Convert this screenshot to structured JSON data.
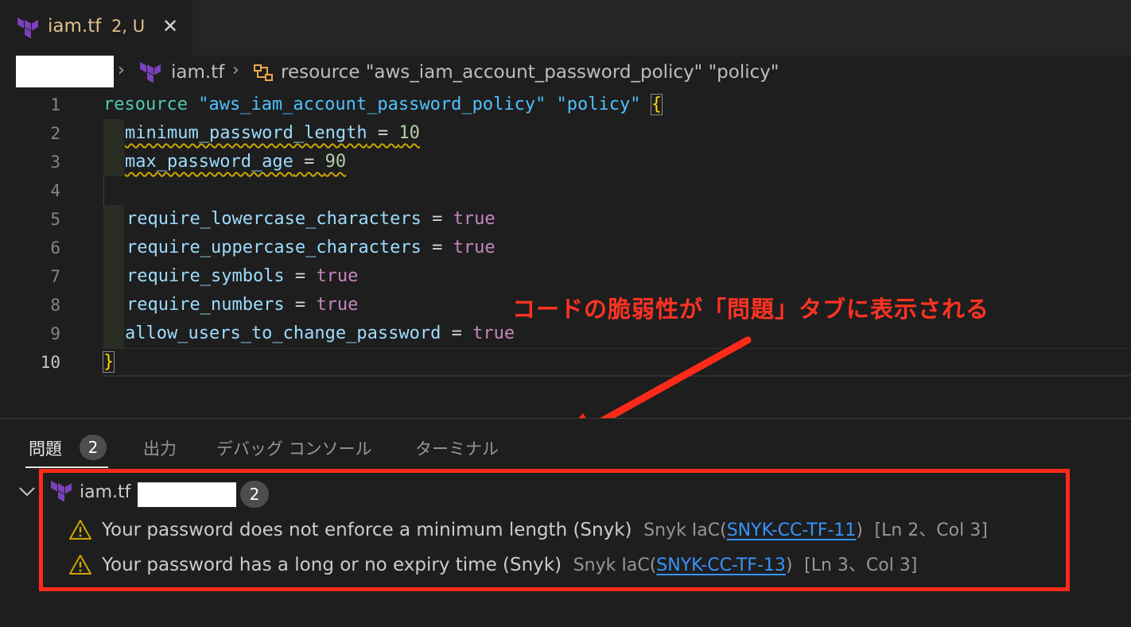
{
  "tab": {
    "file_name": "iam.tf",
    "status": "2, U",
    "close_glyph": "✕"
  },
  "breadcrumb": {
    "separator": "›",
    "file": "iam.tf",
    "symbol": "resource \"aws_iam_account_password_policy\" \"policy\""
  },
  "editor": {
    "lines": [
      {
        "num": "1",
        "text": "resource \"aws_iam_account_password_policy\" \"policy\" {"
      },
      {
        "num": "2",
        "text": "minimum_password_length = 10"
      },
      {
        "num": "3",
        "text": "max_password_age = 90"
      },
      {
        "num": "4",
        "text": ""
      },
      {
        "num": "5",
        "text": "require_lowercase_characters = true"
      },
      {
        "num": "6",
        "text": "require_uppercase_characters = true"
      },
      {
        "num": "7",
        "text": "require_symbols = true"
      },
      {
        "num": "8",
        "text": "require_numbers = true"
      },
      {
        "num": "9",
        "text": "allow_users_to_change_password = true"
      },
      {
        "num": "10",
        "text": "}"
      }
    ],
    "tokens": {
      "resource_kw": "resource",
      "resource_type": "\"aws_iam_account_password_policy\"",
      "resource_name": "\"policy\"",
      "open_brace": "{",
      "close_brace": "}",
      "eq": " = ",
      "l2_attr": "minimum_password_length",
      "l2_val": "10",
      "l3_attr": "max_password_age",
      "l3_val": "90",
      "l5_attr": "require_lowercase_characters",
      "l6_attr": "require_uppercase_characters",
      "l7_attr": "require_symbols",
      "l8_attr": "require_numbers",
      "l9_attr": "allow_users_to_change_password",
      "true_val": "true"
    }
  },
  "annotation": {
    "text": "コードの脆弱性が「問題」タブに表示される"
  },
  "panel": {
    "tabs": [
      {
        "label": "問題",
        "badge": "2",
        "active": true
      },
      {
        "label": "出力"
      },
      {
        "label": "デバッグ コンソール"
      },
      {
        "label": "ターミナル"
      }
    ],
    "group": {
      "file": "iam.tf",
      "count": "2"
    },
    "problems": [
      {
        "message": "Your password does not enforce a minimum length (Snyk)",
        "source": "Snyk IaC(",
        "code": "SNYK-CC-TF-11",
        "source_end": ")",
        "location": "[Ln 2、Col 3]"
      },
      {
        "message": "Your password has a long or no expiry time (Snyk)",
        "source": "Snyk IaC(",
        "code": "SNYK-CC-TF-13",
        "source_end": ")",
        "location": "[Ln 3、Col 3]"
      }
    ]
  },
  "colors": {
    "accent_red": "#ff2a1a",
    "terraform_purple": "#7b42bc",
    "warning_yellow": "#cca700",
    "link_blue": "#3794ff"
  },
  "icons": {
    "terraform": "terraform-icon",
    "symbol": "symbol-structure-icon",
    "warning": "warning-icon",
    "chevron": "chevron-down-icon",
    "close": "close-icon"
  }
}
